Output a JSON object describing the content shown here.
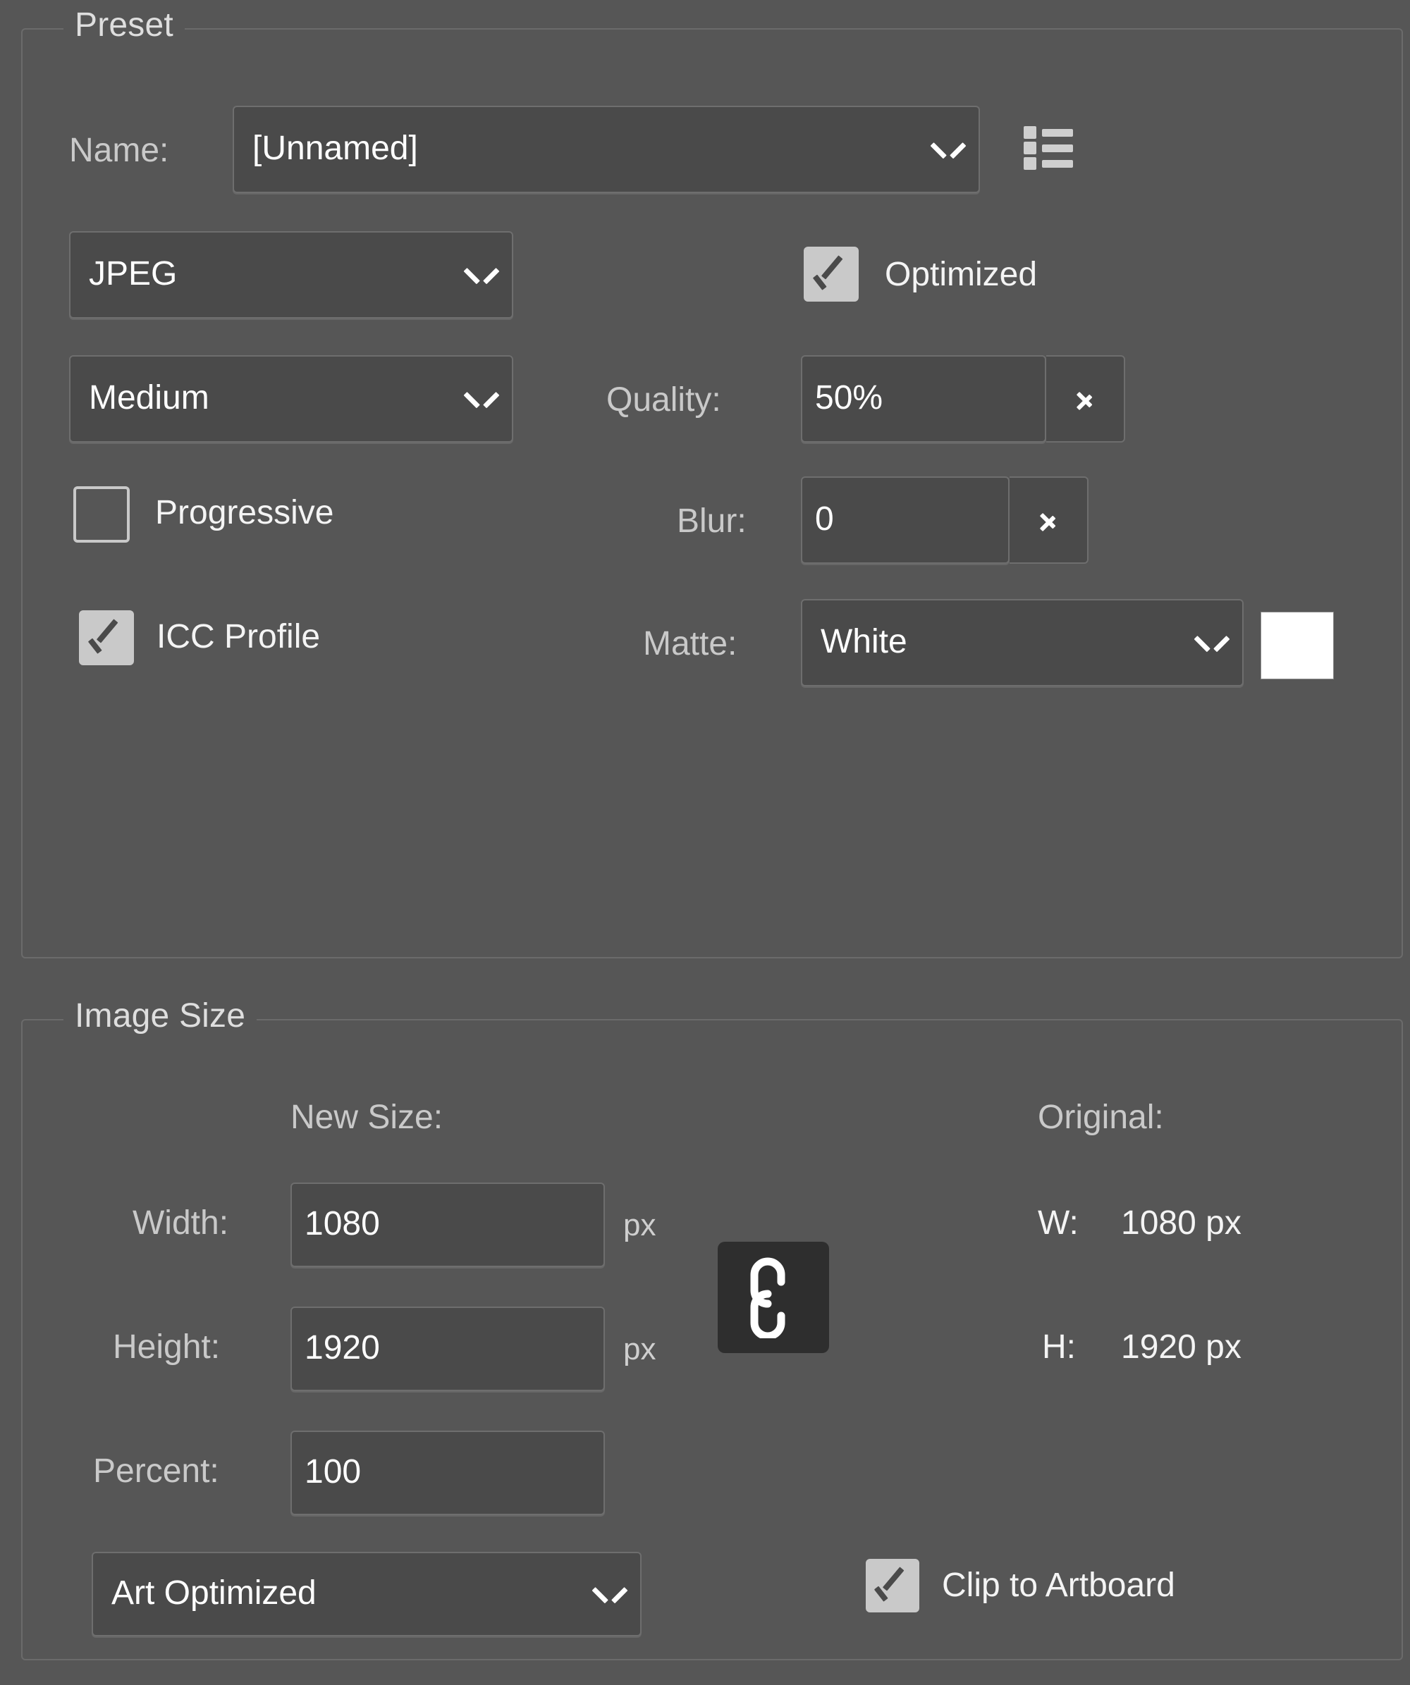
{
  "panel": {
    "background_color": "#565656",
    "field_color": "#4a4a4a",
    "border_color": "#6e6e6e",
    "text_color": "#ffffff",
    "label_color": "#c9c9c9"
  },
  "preset_group": {
    "legend": "Preset",
    "name_label": "Name:",
    "name_value": "[Unnamed]",
    "preset_menu_icon": "list-icon",
    "format_value": "JPEG",
    "optimized_label": "Optimized",
    "optimized_checked": true,
    "compression_value": "Medium",
    "quality_label": "Quality:",
    "quality_value": "50%",
    "quality_stepper_icon": "chevron-right-icon",
    "progressive_label": "Progressive",
    "progressive_checked": false,
    "blur_label": "Blur:",
    "blur_value": "0",
    "blur_stepper_icon": "chevron-right-icon",
    "icc_profile_label": "ICC Profile",
    "icc_profile_checked": true,
    "matte_label": "Matte:",
    "matte_value": "White",
    "matte_swatch_color": "#ffffff"
  },
  "image_size_group": {
    "legend": "Image Size",
    "new_size_label": "New Size:",
    "original_label": "Original:",
    "width_label": "Width:",
    "width_value": "1080",
    "width_unit": "px",
    "height_label": "Height:",
    "height_value": "1920",
    "height_unit": "px",
    "percent_label": "Percent:",
    "percent_value": "100",
    "link_icon": "chain-link-icon",
    "original_w_label": "W:",
    "original_w_value": "1080 px",
    "original_h_label": "H:",
    "original_h_value": "1920 px",
    "anti_alias_value": "Art Optimized",
    "clip_to_artboard_label": "Clip to Artboard",
    "clip_to_artboard_checked": true
  }
}
